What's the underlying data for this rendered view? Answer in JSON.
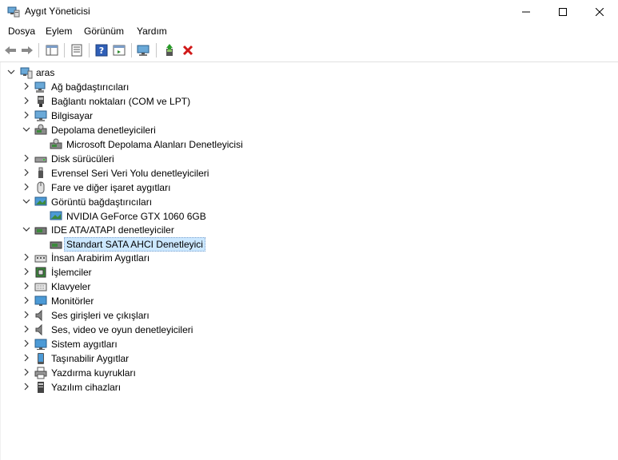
{
  "window": {
    "title": "Aygıt Yöneticisi"
  },
  "menu": [
    "Dosya",
    "Eylem",
    "Görünüm",
    "Yardım"
  ],
  "tree": {
    "root": "aras",
    "items": [
      {
        "label": "Ağ bağdaştırıcıları",
        "icon": "network-adapter-icon",
        "expanded": false,
        "children": []
      },
      {
        "label": "Bağlantı noktaları (COM ve LPT)",
        "icon": "port-icon",
        "expanded": false,
        "children": []
      },
      {
        "label": "Bilgisayar",
        "icon": "computer-icon",
        "expanded": false,
        "children": []
      },
      {
        "label": "Depolama denetleyicileri",
        "icon": "storage-controller-icon",
        "expanded": true,
        "children": [
          {
            "label": "Microsoft Depolama Alanları Denetleyicisi",
            "icon": "storage-controller-icon",
            "selected": false
          }
        ]
      },
      {
        "label": "Disk sürücüleri",
        "icon": "disk-drive-icon",
        "expanded": false,
        "children": []
      },
      {
        "label": "Evrensel Seri Veri Yolu denetleyicileri",
        "icon": "usb-icon",
        "expanded": false,
        "children": []
      },
      {
        "label": "Fare ve diğer işaret aygıtları",
        "icon": "mouse-icon",
        "expanded": false,
        "children": []
      },
      {
        "label": "Görüntü bağdaştırıcıları",
        "icon": "display-adapter-icon",
        "expanded": true,
        "children": [
          {
            "label": "NVIDIA GeForce GTX 1060 6GB",
            "icon": "display-adapter-icon",
            "selected": false
          }
        ]
      },
      {
        "label": "IDE ATA/ATAPI denetleyiciler",
        "icon": "ide-controller-icon",
        "expanded": true,
        "children": [
          {
            "label": "Standart SATA AHCI Denetleyici",
            "icon": "ide-controller-icon",
            "selected": true
          }
        ]
      },
      {
        "label": "İnsan Arabirim Aygıtları",
        "icon": "hid-icon",
        "expanded": false,
        "children": []
      },
      {
        "label": "İşlemciler",
        "icon": "processor-icon",
        "expanded": false,
        "children": []
      },
      {
        "label": "Klavyeler",
        "icon": "keyboard-icon",
        "expanded": false,
        "children": []
      },
      {
        "label": "Monitörler",
        "icon": "monitor-icon",
        "expanded": false,
        "children": []
      },
      {
        "label": "Ses girişleri ve çıkışları",
        "icon": "speaker-icon",
        "expanded": false,
        "children": []
      },
      {
        "label": "Ses, video ve oyun denetleyicileri",
        "icon": "speaker-icon",
        "expanded": false,
        "children": []
      },
      {
        "label": "Sistem aygıtları",
        "icon": "system-devices-icon",
        "expanded": false,
        "children": []
      },
      {
        "label": "Taşınabilir Aygıtlar",
        "icon": "portable-device-icon",
        "expanded": false,
        "children": []
      },
      {
        "label": "Yazdırma kuyrukları",
        "icon": "printer-icon",
        "expanded": false,
        "children": []
      },
      {
        "label": "Yazılım cihazları",
        "icon": "software-device-icon",
        "expanded": false,
        "children": []
      }
    ]
  }
}
